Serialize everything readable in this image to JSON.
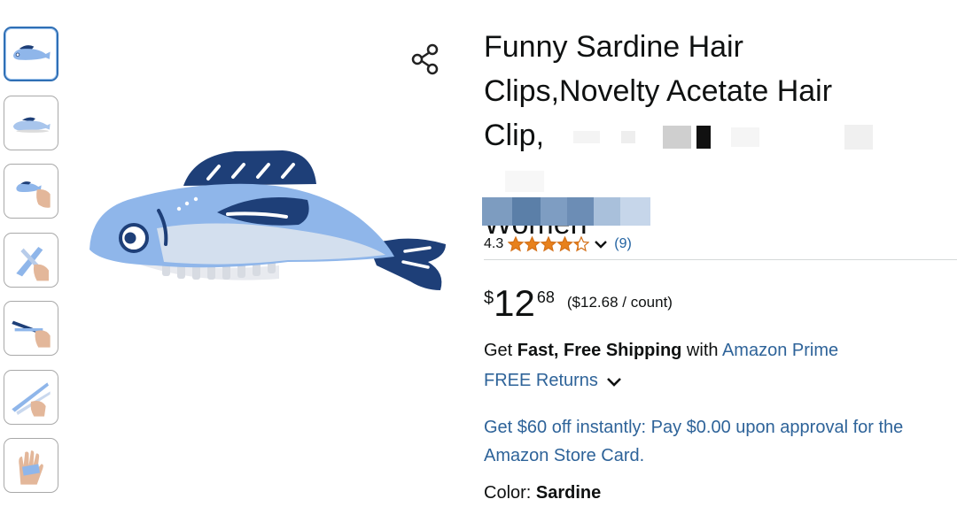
{
  "thumbnails": [
    {
      "label": "fish clip side view",
      "active": true
    },
    {
      "label": "fish clip angled view",
      "active": false
    },
    {
      "label": "fish clip in hand",
      "active": false
    },
    {
      "label": "clip open in hand",
      "active": false
    },
    {
      "label": "clip holding",
      "active": false
    },
    {
      "label": "clip clamp view",
      "active": false
    },
    {
      "label": "hand with clip",
      "active": false
    }
  ],
  "share": {
    "icon": "share-icon"
  },
  "product": {
    "title_line1": "Funny Sardine Hair",
    "title_line2": "Clips,Novelty Acetate Hair",
    "title_line3": "Clip,",
    "title_line4": "Women"
  },
  "rating": {
    "value": "4.3",
    "stars": 4.3,
    "count": "(9)"
  },
  "price": {
    "symbol": "$",
    "whole": "12",
    "fraction": "68",
    "unit": "($12.68 / count)"
  },
  "shipping": {
    "prefix": "Get ",
    "bold": "Fast, Free Shipping",
    "mid": " with ",
    "prime": "Amazon Prime",
    "returns": "FREE Returns"
  },
  "offer": {
    "line1": "Get $60 off instantly: Pay $0.00 upon approval for the",
    "line2": "Amazon Store Card."
  },
  "color": {
    "label": "Color: ",
    "value": "Sardine"
  },
  "colors": {
    "link": "#2e6399",
    "star": "#e8811c",
    "border_active": "#2f6fb5",
    "fish_light": "#8fb6ea",
    "fish_dark": "#1e3f78"
  }
}
